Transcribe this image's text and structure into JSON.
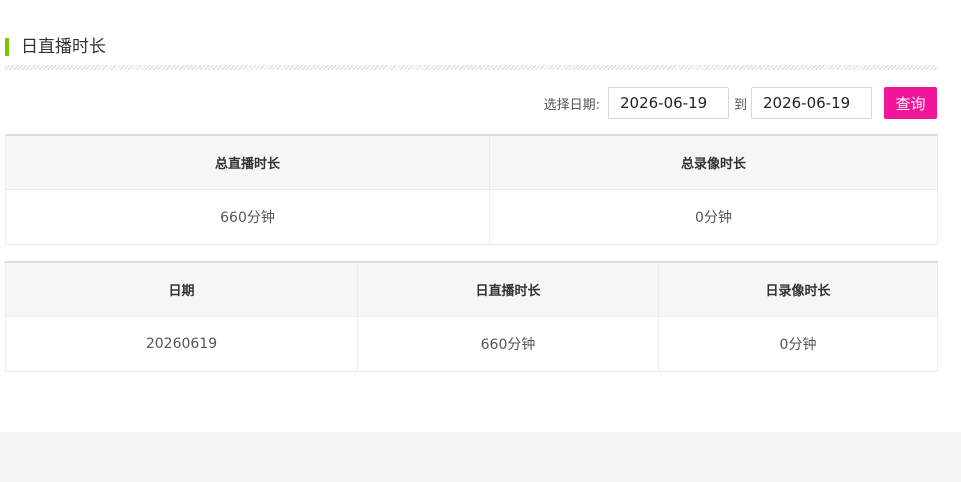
{
  "section": {
    "title": "日直播时长"
  },
  "query": {
    "label": "选择日期:",
    "start_date": "2026-06-19",
    "to_label": "到",
    "end_date": "2026-06-19",
    "button_label": "查询"
  },
  "summary_table": {
    "headers": [
      "总直播时长",
      "总录像时长"
    ],
    "rows": [
      [
        "660分钟",
        "0分钟"
      ]
    ]
  },
  "daily_table": {
    "headers": [
      "日期",
      "日直播时长",
      "日录像时长"
    ],
    "rows": [
      [
        "20260619",
        "660分钟",
        "0分钟"
      ]
    ]
  },
  "colors": {
    "accent_green": "#7cc400",
    "button_pink": "#f0159a",
    "header_bg": "#f6f6f6",
    "footer_bg": "#f4f4f4"
  }
}
